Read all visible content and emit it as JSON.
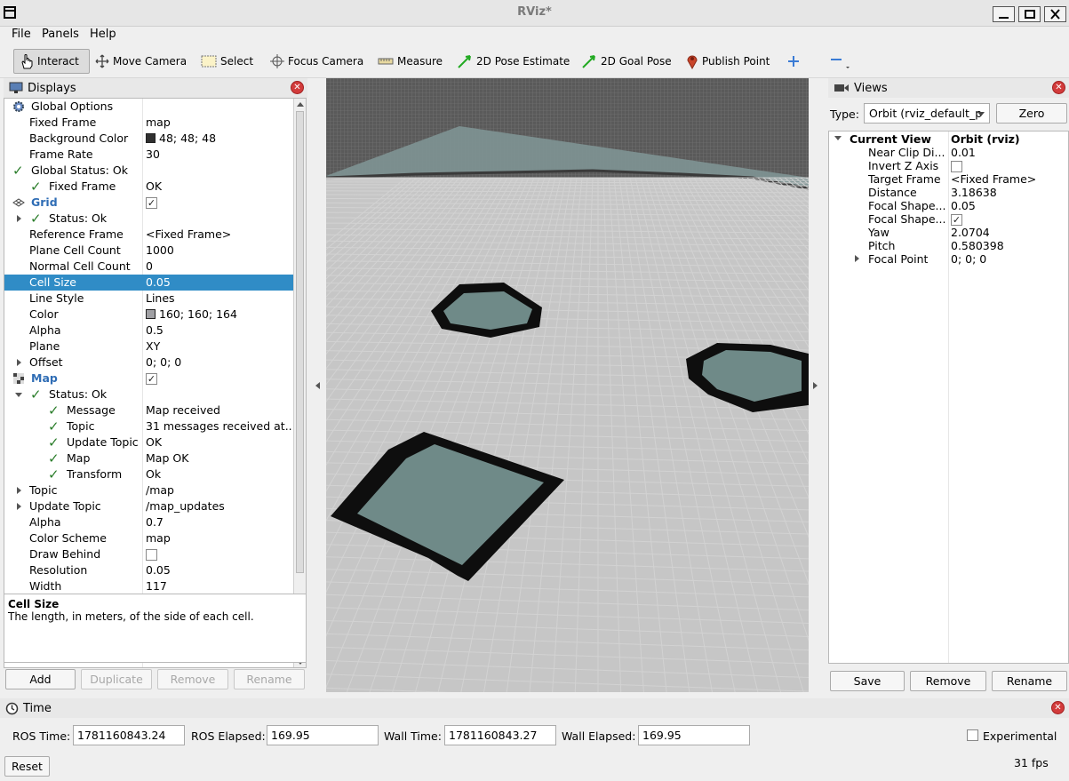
{
  "window": {
    "title": "RViz*"
  },
  "menu": [
    "File",
    "Panels",
    "Help"
  ],
  "toolbar": {
    "interact": "Interact",
    "move_camera": "Move Camera",
    "select": "Select",
    "focus_camera": "Focus Camera",
    "measure": "Measure",
    "pose_estimate": "2D Pose Estimate",
    "goal_pose": "2D Goal Pose",
    "publish_point": "Publish Point"
  },
  "displays": {
    "title": "Displays",
    "rows": [
      {
        "k": "Global Options",
        "v": ""
      },
      {
        "k": "Fixed Frame",
        "v": "map"
      },
      {
        "k": "Background Color",
        "v": "48; 48; 48",
        "swatch": "#303030"
      },
      {
        "k": "Frame Rate",
        "v": "30"
      },
      {
        "k": "Global Status: Ok",
        "v": ""
      },
      {
        "k": "Fixed Frame",
        "v": "OK"
      },
      {
        "k": "Grid",
        "v": ""
      },
      {
        "k": "Status: Ok",
        "v": ""
      },
      {
        "k": "Reference Frame",
        "v": "<Fixed Frame>"
      },
      {
        "k": "Plane Cell Count",
        "v": "1000"
      },
      {
        "k": "Normal Cell Count",
        "v": "0"
      },
      {
        "k": "Cell Size",
        "v": "0.05"
      },
      {
        "k": "Line Style",
        "v": "Lines"
      },
      {
        "k": "Color",
        "v": "160; 160; 164",
        "swatch": "#a0a0a4"
      },
      {
        "k": "Alpha",
        "v": "0.5"
      },
      {
        "k": "Plane",
        "v": "XY"
      },
      {
        "k": "Offset",
        "v": "0; 0; 0"
      },
      {
        "k": "Map",
        "v": ""
      },
      {
        "k": "Status: Ok",
        "v": ""
      },
      {
        "k": "Message",
        "v": "Map received"
      },
      {
        "k": "Topic",
        "v": "31 messages received at..."
      },
      {
        "k": "Update Topic",
        "v": "OK"
      },
      {
        "k": "Map",
        "v": "Map OK"
      },
      {
        "k": "Transform",
        "v": "Ok"
      },
      {
        "k": "Topic",
        "v": "/map"
      },
      {
        "k": "Update Topic",
        "v": "/map_updates"
      },
      {
        "k": "Alpha",
        "v": "0.7"
      },
      {
        "k": "Color Scheme",
        "v": "map"
      },
      {
        "k": "Draw Behind",
        "v": ""
      },
      {
        "k": "Resolution",
        "v": "0.05"
      },
      {
        "k": "Width",
        "v": "117"
      }
    ],
    "description": {
      "title": "Cell Size",
      "text": "The length, in meters, of the side of each cell."
    },
    "buttons": {
      "add": "Add",
      "duplicate": "Duplicate",
      "remove": "Remove",
      "rename": "Rename"
    }
  },
  "views": {
    "title": "Views",
    "type_label": "Type:",
    "type_value": "Orbit (rviz_default_p",
    "zero": "Zero",
    "current_view": "Current View",
    "current_view_value": "Orbit (rviz)",
    "rows": [
      {
        "k": "Near Clip Di...",
        "v": "0.01"
      },
      {
        "k": "Invert Z Axis",
        "v": ""
      },
      {
        "k": "Target Frame",
        "v": "<Fixed Frame>"
      },
      {
        "k": "Distance",
        "v": "3.18638"
      },
      {
        "k": "Focal Shape...",
        "v": "0.05"
      },
      {
        "k": "Focal Shape...",
        "v": ""
      },
      {
        "k": "Yaw",
        "v": "2.0704"
      },
      {
        "k": "Pitch",
        "v": "0.580398"
      },
      {
        "k": "Focal Point",
        "v": "0; 0; 0"
      }
    ],
    "buttons": {
      "save": "Save",
      "remove": "Remove",
      "rename": "Rename"
    }
  },
  "time": {
    "title": "Time",
    "ros_time_label": "ROS Time:",
    "ros_time": "1781160843.24",
    "ros_elapsed_label": "ROS Elapsed:",
    "ros_elapsed": "169.95",
    "wall_time_label": "Wall Time:",
    "wall_time": "1781160843.27",
    "wall_elapsed_label": "Wall Elapsed:",
    "wall_elapsed": "169.95",
    "experimental": "Experimental",
    "reset": "Reset",
    "fps": "31 fps"
  }
}
